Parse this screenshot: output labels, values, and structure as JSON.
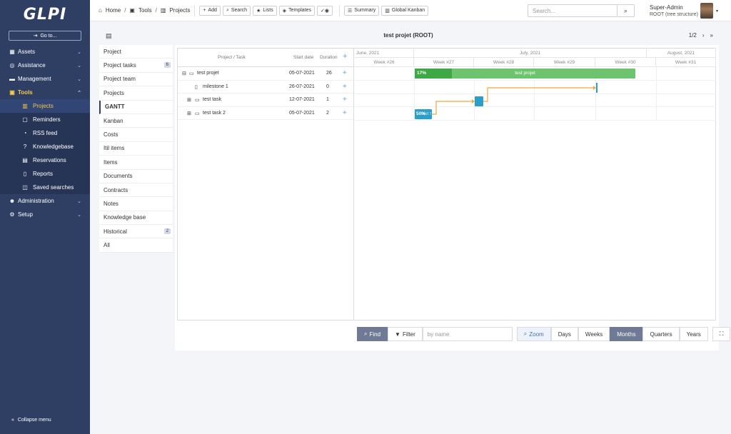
{
  "app": {
    "logo": "GLPI",
    "goto_label": "Go to...",
    "collapse_label": "Collapse menu"
  },
  "sidebar": {
    "top_items": [
      {
        "label": "Assets"
      },
      {
        "label": "Assistance"
      },
      {
        "label": "Management"
      },
      {
        "label": "Tools"
      }
    ],
    "sub_items": [
      {
        "label": "Projects"
      },
      {
        "label": "Reminders"
      },
      {
        "label": "RSS feed"
      },
      {
        "label": "Knowledgebase"
      },
      {
        "label": "Reservations"
      },
      {
        "label": "Reports"
      },
      {
        "label": "Saved searches"
      }
    ],
    "bottom_items": [
      {
        "label": "Administration"
      },
      {
        "label": "Setup"
      }
    ]
  },
  "header": {
    "breadcrumb": [
      "Home",
      "Tools",
      "Projects"
    ],
    "buttons": [
      "Add",
      "Search",
      "Lists",
      "Templates",
      "Summary",
      "Global Kanban"
    ],
    "search_placeholder": "Search...",
    "user_name": "Super-Admin",
    "user_role": "ROOT (tree structure)"
  },
  "page": {
    "title": "test projet (ROOT)",
    "pager": "1/2"
  },
  "tabs": [
    {
      "label": "Project",
      "badge": ""
    },
    {
      "label": "Project tasks",
      "badge": "6"
    },
    {
      "label": "Project team",
      "badge": ""
    },
    {
      "label": "Projects",
      "badge": ""
    },
    {
      "label": "GANTT",
      "badge": ""
    },
    {
      "label": "Kanban",
      "badge": ""
    },
    {
      "label": "Costs",
      "badge": ""
    },
    {
      "label": "Itil items",
      "badge": ""
    },
    {
      "label": "Items",
      "badge": ""
    },
    {
      "label": "Documents",
      "badge": ""
    },
    {
      "label": "Contracts",
      "badge": ""
    },
    {
      "label": "Notes",
      "badge": ""
    },
    {
      "label": "Knowledge base",
      "badge": ""
    },
    {
      "label": "Historical",
      "badge": "2"
    },
    {
      "label": "All",
      "badge": ""
    }
  ],
  "gantt": {
    "columns": {
      "task": "Project / Task",
      "start": "Start date",
      "duration": "Duration"
    },
    "rows": [
      {
        "name": "test projet",
        "start": "05-07-2021",
        "duration": "26"
      },
      {
        "name": "milestone 1",
        "start": "26-07-2021",
        "duration": "0"
      },
      {
        "name": "test task",
        "start": "12-07-2021",
        "duration": "1"
      },
      {
        "name": "test task 2",
        "start": "05-07-2021",
        "duration": "2"
      }
    ],
    "months": [
      "June, 2021",
      "July, 2021",
      "August, 2021"
    ],
    "weeks": [
      "Week #26",
      "Week #27",
      "Week #28",
      "Week #29",
      "Week #30",
      "Week #31"
    ],
    "bars": {
      "project_progress": "17%",
      "project_label": "test projet",
      "task2_label": "50%",
      "task2_name": "test t"
    },
    "colors": {
      "project": "#6cc46f",
      "project_done": "#3fa846",
      "task": "#2b9fc9",
      "link": "#f2a83a"
    }
  },
  "footer": {
    "find": "Find",
    "filter": "Filter",
    "filter_placeholder": "by name",
    "zoom": "Zoom",
    "scales": [
      "Days",
      "Weeks",
      "Months",
      "Quarters",
      "Years"
    ]
  }
}
